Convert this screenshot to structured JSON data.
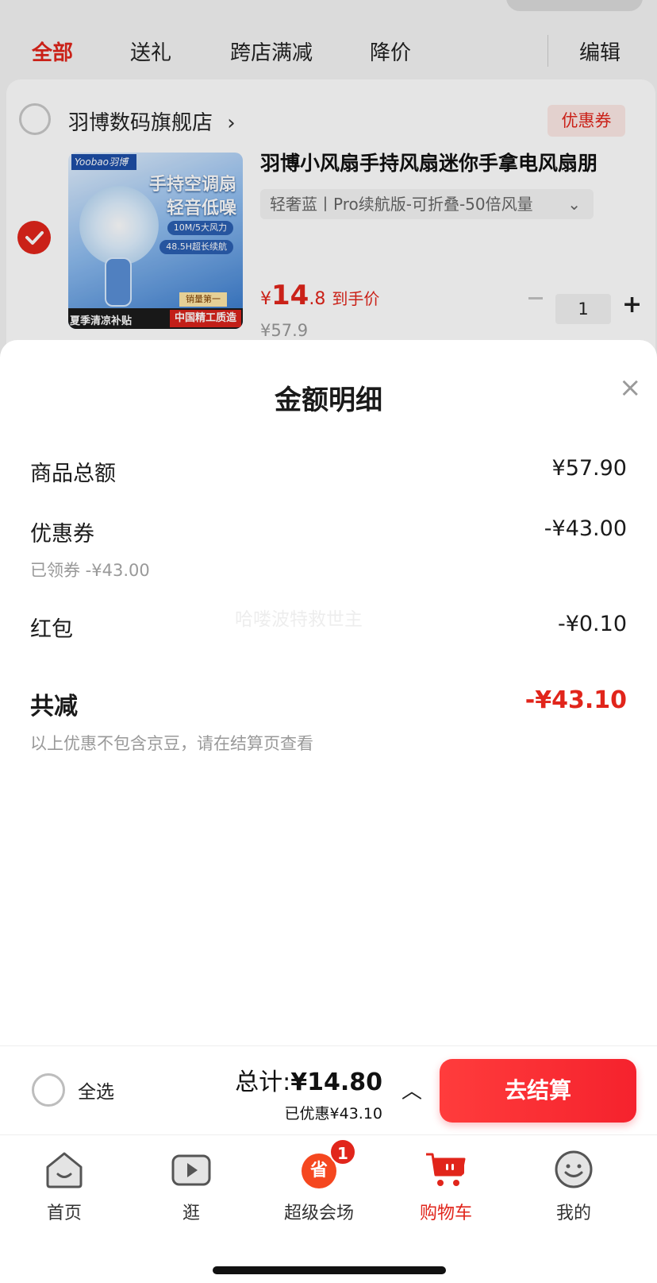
{
  "tabs": [
    "全部",
    "送礼",
    "跨店满减",
    "降价"
  ],
  "edit_label": "编辑",
  "store": {
    "name": "羽博数码旗舰店",
    "chevron": "›",
    "coupon_tag": "优惠券"
  },
  "product": {
    "title": "羽博小风扇手持风扇迷你手拿电风扇朋",
    "spec": "轻奢蓝丨Pro续航版-可折叠-50倍风量",
    "spec_chevron": "⌄",
    "price_symbol": "¥",
    "price_int": "14",
    "price_dec": ".8",
    "price_tag": "到手价",
    "original_price": "¥57.9",
    "quantity": "1",
    "plus": "+",
    "image": {
      "brand": "Yoobao羽博",
      "line1": "手持空调扇",
      "line2": "轻音低噪",
      "tag1": "10M/5大风力",
      "tag2": "48.5H超长续航",
      "badge": "销量第一",
      "bottom_left": "夏季清凉补贴",
      "bottom_right": "中国精工质造"
    }
  },
  "sheet": {
    "title": "金额明细",
    "close": "×",
    "watermark": "哈喽波特救世主",
    "rows": [
      {
        "label": "商品总额",
        "value": "¥57.90"
      },
      {
        "label": "优惠券",
        "value": "-¥43.00",
        "sub": "已领券 -¥43.00"
      },
      {
        "label": "红包",
        "value": "-¥0.10"
      }
    ],
    "total_label": "共减",
    "total_value": "-¥43.10",
    "note": "以上优惠不包含京豆，请在结算页查看"
  },
  "checkout": {
    "select_all": "全选",
    "total_label": "总计:",
    "total_value": "¥14.80",
    "saved": "已优惠¥43.10",
    "caret": "︿",
    "button": "去结算"
  },
  "tabbar": {
    "items": [
      {
        "label": "首页",
        "icon": "home-icon"
      },
      {
        "label": "逛",
        "icon": "video-play-icon"
      },
      {
        "label": "超级会场",
        "icon": "super-venue-icon",
        "badge": "1",
        "glyph": "省"
      },
      {
        "label": "购物车",
        "icon": "cart-icon",
        "active": true
      },
      {
        "label": "我的",
        "icon": "smiley-profile-icon"
      }
    ]
  },
  "colors": {
    "accent": "#e1251b",
    "pay_button": "#f5222d"
  }
}
